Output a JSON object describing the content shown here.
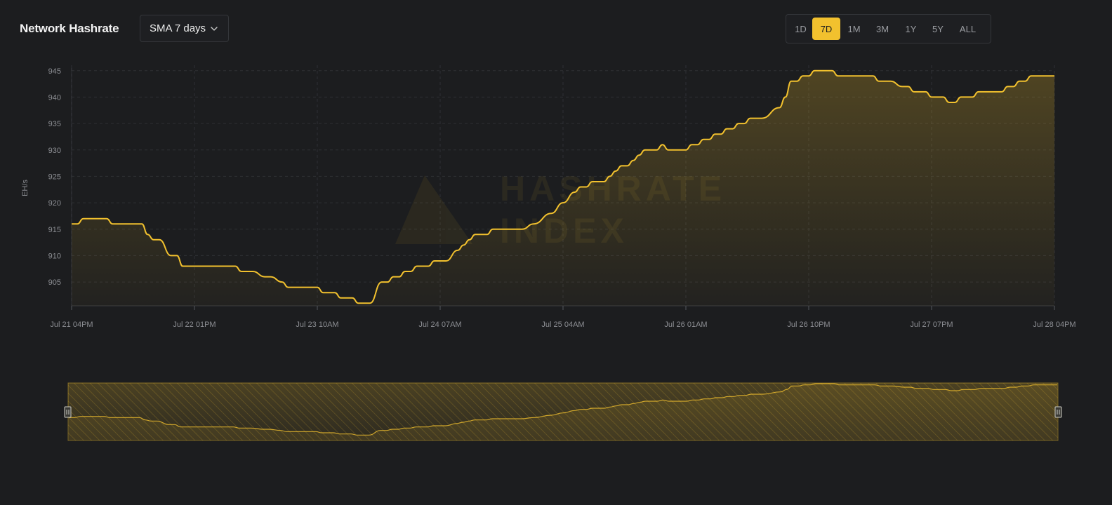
{
  "header": {
    "title": "Network Hashrate",
    "dropdown_value": "SMA 7 days",
    "ranges": [
      "1D",
      "7D",
      "1M",
      "3M",
      "1Y",
      "5Y",
      "ALL"
    ],
    "active_range": "7D"
  },
  "colors": {
    "accent": "#f2c12e",
    "background": "#1c1d1f",
    "grid": "#2e3034",
    "axis_text": "#8c8e93"
  },
  "watermark": {
    "line1": "HASHRATE",
    "line2": "INDEX"
  },
  "chart_data": {
    "type": "area",
    "ylabel": "EH/s",
    "ylim": [
      900.5,
      945.5
    ],
    "yticks": [
      905,
      910,
      915,
      920,
      925,
      930,
      935,
      940,
      945
    ],
    "xlim": [
      0,
      168
    ],
    "xticks": [
      {
        "x": 0,
        "label": "Jul 21 04PM"
      },
      {
        "x": 21,
        "label": "Jul 22 01PM"
      },
      {
        "x": 42,
        "label": "Jul 23 10AM"
      },
      {
        "x": 63,
        "label": "Jul 24 07AM"
      },
      {
        "x": 84,
        "label": "Jul 25 04AM"
      },
      {
        "x": 105,
        "label": "Jul 26 01AM"
      },
      {
        "x": 126,
        "label": "Jul 26 10PM"
      },
      {
        "x": 147,
        "label": "Jul 27 07PM"
      },
      {
        "x": 168,
        "label": "Jul 28 04PM"
      }
    ],
    "grid": true,
    "x_unit": "hours since Jul 21 04PM",
    "series": [
      {
        "x": [
          0,
          1,
          2,
          4,
          6,
          7,
          8,
          11,
          12,
          13,
          14,
          15,
          17,
          18,
          19,
          20,
          21,
          24,
          28,
          29,
          30,
          31,
          33,
          34,
          36,
          37,
          40,
          42,
          43,
          45,
          46,
          47,
          48,
          49,
          50,
          51,
          53,
          54,
          55,
          56,
          57,
          58,
          59,
          60,
          61,
          62,
          64,
          66,
          67,
          68,
          69,
          71,
          72,
          73,
          74,
          75,
          77,
          79,
          82,
          84,
          86,
          87,
          88,
          89,
          90,
          91,
          92,
          93,
          94,
          95,
          96,
          97,
          98,
          99,
          100,
          101,
          102,
          103,
          104,
          105,
          106,
          107,
          108,
          109,
          110,
          111,
          112,
          113,
          114,
          115,
          116,
          118,
          121,
          122,
          123,
          124,
          125,
          126,
          127,
          128,
          129,
          130,
          131,
          132,
          133,
          134,
          136,
          137,
          138,
          139,
          140,
          142,
          143,
          144,
          145,
          146,
          147,
          148,
          149,
          150,
          151,
          152,
          153,
          154,
          155,
          156,
          157,
          158,
          159,
          160,
          161,
          162,
          163,
          164,
          165,
          166,
          167,
          168
        ],
        "values": [
          916,
          916,
          917,
          917,
          917,
          916,
          916,
          916,
          916,
          914,
          913,
          913,
          910,
          910,
          908,
          908,
          908,
          908,
          908,
          907,
          907,
          907,
          906,
          906,
          905,
          904,
          904,
          904,
          903,
          903,
          902,
          902,
          902,
          901,
          901,
          901,
          905,
          905,
          906,
          906,
          907,
          907,
          908,
          908,
          908,
          909,
          909,
          911,
          912,
          913,
          914,
          914,
          915,
          915,
          915,
          915,
          915,
          916,
          918,
          920,
          922,
          923,
          923,
          924,
          924,
          924,
          925,
          926,
          927,
          927,
          928,
          929,
          930,
          930,
          930,
          931,
          930,
          930,
          930,
          930,
          931,
          931,
          932,
          932,
          933,
          933,
          934,
          934,
          935,
          935,
          936,
          936,
          938,
          940,
          943,
          943,
          944,
          944,
          945,
          945,
          945,
          945,
          944,
          944,
          944,
          944,
          944,
          944,
          943,
          943,
          943,
          942,
          942,
          941,
          941,
          941,
          940,
          940,
          940,
          939,
          939,
          940,
          940,
          940,
          941,
          941,
          941,
          941,
          941,
          942,
          942,
          943,
          943,
          944,
          944,
          944,
          944,
          944
        ]
      }
    ]
  }
}
